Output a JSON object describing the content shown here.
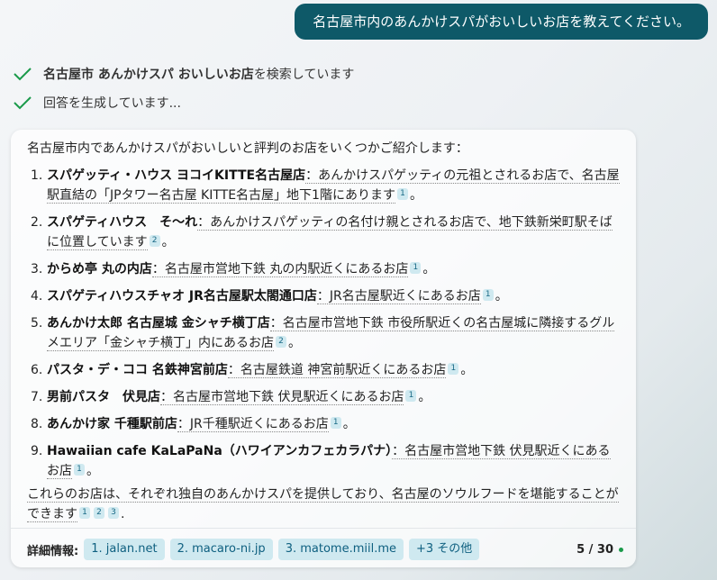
{
  "user_message": "名古屋市内のあんかけスパがおいしいお店を教えてください。",
  "status": {
    "searching_query": "名古屋市 あんかけスパ おいしいお店",
    "searching_suffix": " を検索しています",
    "generating": "回答を生成しています..."
  },
  "answer": {
    "intro": "名古屋市内であんかけスパがおいしいと評判のお店をいくつかご紹介します：",
    "items": [
      {
        "num": "1.",
        "name": "スパゲッティ・ハウス ヨコイKITTE名古屋店",
        "desc": "：あんかけスパゲッティの元祖とされるお店で、名古屋駅直結の「JPタワー名古屋 KITTE名古屋」地下1階にあります",
        "cite": "1",
        "end": "。"
      },
      {
        "num": "2.",
        "name": "スパゲティハウス　そ〜れ",
        "desc": "：あんかけスパゲッティの名付け親とされるお店で、地下鉄新栄町駅そばに位置しています",
        "cite": "2",
        "end": "。"
      },
      {
        "num": "3.",
        "name": "からめ亭 丸の内店",
        "desc": "：名古屋市営地下鉄 丸の内駅近くにあるお店",
        "cite": "1",
        "end": "。"
      },
      {
        "num": "4.",
        "name": "スパゲティハウスチャオ JR名古屋駅太閤通口店",
        "desc": "：JR名古屋駅近くにあるお店",
        "cite": "1",
        "end": "。"
      },
      {
        "num": "5.",
        "name": "あんかけ太郎 名古屋城 金シャチ横丁店",
        "desc": "：名古屋市営地下鉄 市役所駅近くの名古屋城に隣接するグルメエリア「金シャチ横丁」内にあるお店",
        "cite": "2",
        "end": "。"
      },
      {
        "num": "6.",
        "name": "パスタ・デ・ココ 名鉄神宮前店",
        "desc": "：名古屋鉄道 神宮前駅近くにあるお店",
        "cite": "1",
        "end": "。"
      },
      {
        "num": "7.",
        "name": "男前パスタ　伏見店",
        "desc": "：名古屋市営地下鉄 伏見駅近くにあるお店",
        "cite": "1",
        "end": "。"
      },
      {
        "num": "8.",
        "name": "あんかけ家 千種駅前店",
        "desc": "：JR千種駅近くにあるお店",
        "cite": "1",
        "end": "。"
      },
      {
        "num": "9.",
        "name": "Hawaiian cafe KaLaPaNa（ハワイアンカフェカラパナ）",
        "desc": "：名古屋市営地下鉄 伏見駅近くにあるお店",
        "cite": "1",
        "end": "。"
      }
    ],
    "closing": "これらのお店は、それぞれ独自のあんかけスパを提供しており、名古屋のソウルフードを堪能することができます",
    "closing_cites": [
      "1",
      "2",
      "3"
    ],
    "closing_end": "."
  },
  "footer": {
    "label": "詳細情報:",
    "sources": [
      "1. jalan.net",
      "2. macaro-ni.jp",
      "3. matome.miil.me"
    ],
    "more": "+3 その他",
    "count": "5 / 30"
  },
  "colors": {
    "user_bubble": "#0e5968",
    "check": "#1a9a4a",
    "chip_bg": "#cfe9f0",
    "chip_text": "#0f6080"
  }
}
